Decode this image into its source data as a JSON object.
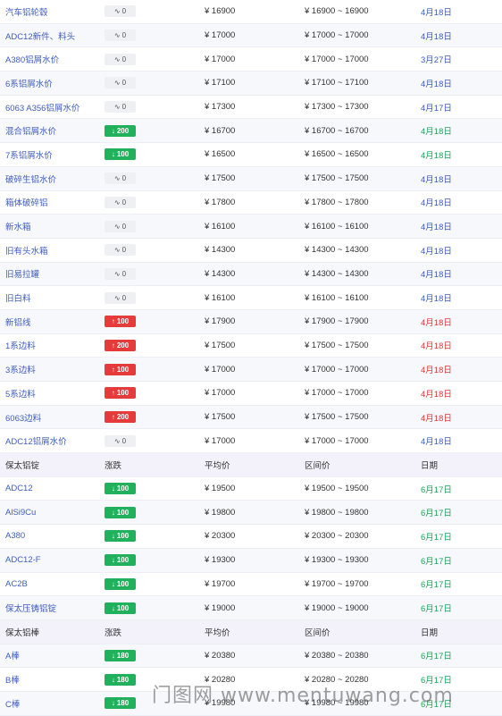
{
  "table": {
    "rows": [
      {
        "type": "item",
        "name": "汽车铝轮毂",
        "chg": "0",
        "dir": "zero",
        "avg": "¥ 16900",
        "range": "¥ 16900 ~ 16900",
        "date": "4月18日",
        "date_color": "blue"
      },
      {
        "type": "item",
        "name": "ADC12新件、料头",
        "chg": "0",
        "dir": "zero",
        "avg": "¥ 17000",
        "range": "¥ 17000 ~ 17000",
        "date": "4月18日",
        "date_color": "blue"
      },
      {
        "type": "item",
        "name": "A380铝屑水价",
        "chg": "0",
        "dir": "zero",
        "avg": "¥ 17000",
        "range": "¥ 17000 ~ 17000",
        "date": "3月27日",
        "date_color": "blue"
      },
      {
        "type": "item",
        "name": "6系铝屑水价",
        "chg": "0",
        "dir": "zero",
        "avg": "¥ 17100",
        "range": "¥ 17100 ~ 17100",
        "date": "4月18日",
        "date_color": "blue"
      },
      {
        "type": "item",
        "name": "6063 A356铝屑水价",
        "chg": "0",
        "dir": "zero",
        "avg": "¥ 17300",
        "range": "¥ 17300 ~ 17300",
        "date": "4月17日",
        "date_color": "blue"
      },
      {
        "type": "item",
        "name": "混合铝屑水价",
        "chg": "200",
        "dir": "down",
        "avg": "¥ 16700",
        "range": "¥ 16700 ~ 16700",
        "date": "4月18日",
        "date_color": "green"
      },
      {
        "type": "item",
        "name": "7系铝屑水价",
        "chg": "100",
        "dir": "down",
        "avg": "¥ 16500",
        "range": "¥ 16500 ~ 16500",
        "date": "4月18日",
        "date_color": "green"
      },
      {
        "type": "item",
        "name": "破碎生铝水价",
        "chg": "0",
        "dir": "zero",
        "avg": "¥ 17500",
        "range": "¥ 17500 ~ 17500",
        "date": "4月18日",
        "date_color": "blue"
      },
      {
        "type": "item",
        "name": "箱体破碎铝",
        "chg": "0",
        "dir": "zero",
        "avg": "¥ 17800",
        "range": "¥ 17800 ~ 17800",
        "date": "4月18日",
        "date_color": "blue"
      },
      {
        "type": "item",
        "name": "新水箱",
        "chg": "0",
        "dir": "zero",
        "avg": "¥ 16100",
        "range": "¥ 16100 ~ 16100",
        "date": "4月18日",
        "date_color": "blue"
      },
      {
        "type": "item",
        "name": "旧有头水箱",
        "chg": "0",
        "dir": "zero",
        "avg": "¥ 14300",
        "range": "¥ 14300 ~ 14300",
        "date": "4月18日",
        "date_color": "blue"
      },
      {
        "type": "item",
        "name": "旧易拉罐",
        "chg": "0",
        "dir": "zero",
        "avg": "¥ 14300",
        "range": "¥ 14300 ~ 14300",
        "date": "4月18日",
        "date_color": "blue"
      },
      {
        "type": "item",
        "name": "旧白料",
        "chg": "0",
        "dir": "zero",
        "avg": "¥ 16100",
        "range": "¥ 16100 ~ 16100",
        "date": "4月18日",
        "date_color": "blue"
      },
      {
        "type": "item",
        "name": "新铝线",
        "chg": "100",
        "dir": "up",
        "avg": "¥ 17900",
        "range": "¥ 17900 ~ 17900",
        "date": "4月18日",
        "date_color": "red"
      },
      {
        "type": "item",
        "name": "1系边料",
        "chg": "200",
        "dir": "up",
        "avg": "¥ 17500",
        "range": "¥ 17500 ~ 17500",
        "date": "4月18日",
        "date_color": "red"
      },
      {
        "type": "item",
        "name": "3系边料",
        "chg": "100",
        "dir": "up",
        "avg": "¥ 17000",
        "range": "¥ 17000 ~ 17000",
        "date": "4月18日",
        "date_color": "red"
      },
      {
        "type": "item",
        "name": "5系边料",
        "chg": "100",
        "dir": "up",
        "avg": "¥ 17000",
        "range": "¥ 17000 ~ 17000",
        "date": "4月18日",
        "date_color": "red"
      },
      {
        "type": "item",
        "name": "6063边料",
        "chg": "200",
        "dir": "up",
        "avg": "¥ 17500",
        "range": "¥ 17500 ~ 17500",
        "date": "4月18日",
        "date_color": "red"
      },
      {
        "type": "item",
        "name": "ADC12铝屑水价",
        "chg": "0",
        "dir": "zero",
        "avg": "¥ 17000",
        "range": "¥ 17000 ~ 17000",
        "date": "4月18日",
        "date_color": "blue"
      },
      {
        "type": "header",
        "name": "保太铝锭",
        "chg": "涨跌",
        "avg": "平均价",
        "range": "区间价",
        "date": "日期"
      },
      {
        "type": "item",
        "name": "ADC12",
        "chg": "100",
        "dir": "down",
        "avg": "¥ 19500",
        "range": "¥ 19500 ~ 19500",
        "date": "6月17日",
        "date_color": "green"
      },
      {
        "type": "item",
        "name": "AlSi9Cu",
        "chg": "100",
        "dir": "down",
        "avg": "¥ 19800",
        "range": "¥ 19800 ~ 19800",
        "date": "6月17日",
        "date_color": "green"
      },
      {
        "type": "item",
        "name": "A380",
        "chg": "100",
        "dir": "down",
        "avg": "¥ 20300",
        "range": "¥ 20300 ~ 20300",
        "date": "6月17日",
        "date_color": "green"
      },
      {
        "type": "item",
        "name": "ADC12-F",
        "chg": "100",
        "dir": "down",
        "avg": "¥ 19300",
        "range": "¥ 19300 ~ 19300",
        "date": "6月17日",
        "date_color": "green"
      },
      {
        "type": "item",
        "name": "AC2B",
        "chg": "100",
        "dir": "down",
        "avg": "¥ 19700",
        "range": "¥ 19700 ~ 19700",
        "date": "6月17日",
        "date_color": "green"
      },
      {
        "type": "item",
        "name": "保太压铸铝锭",
        "chg": "100",
        "dir": "down",
        "avg": "¥ 19000",
        "range": "¥ 19000 ~ 19000",
        "date": "6月17日",
        "date_color": "green"
      },
      {
        "type": "header",
        "name": "保太铝棒",
        "chg": "涨跌",
        "avg": "平均价",
        "range": "区间价",
        "date": "日期"
      },
      {
        "type": "item",
        "name": "A棒",
        "chg": "180",
        "dir": "down",
        "avg": "¥ 20380",
        "range": "¥ 20380 ~ 20380",
        "date": "6月17日",
        "date_color": "green"
      },
      {
        "type": "item",
        "name": "B棒",
        "chg": "180",
        "dir": "down",
        "avg": "¥ 20280",
        "range": "¥ 20280 ~ 20280",
        "date": "6月17日",
        "date_color": "green"
      },
      {
        "type": "item",
        "name": "C棒",
        "chg": "180",
        "dir": "down",
        "avg": "¥ 19980",
        "range": "¥ 19980 ~ 19980",
        "date": "6月17日",
        "date_color": "green"
      }
    ]
  },
  "icons": {
    "zero": "wave-icon",
    "up": "up-arrow-icon",
    "down": "down-arrow-icon"
  },
  "colors": {
    "up": "#e63b3b",
    "down": "#21b15c",
    "link": "#3f5dbf"
  },
  "watermark": "门图网 www.mentuwang.com"
}
